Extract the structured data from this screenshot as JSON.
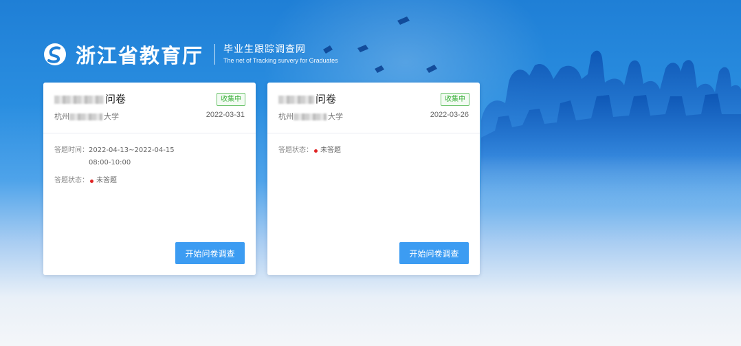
{
  "header": {
    "org_title": "浙江省教育厅",
    "system_title_cn": "毕业生跟踪调查网",
    "system_title_en": "The net of Tracking survery for Graduates"
  },
  "cards": [
    {
      "title_suffix": "问卷",
      "status_badge": "收集中",
      "school_prefix": "杭州",
      "school_suffix": "大学",
      "date": "2022-03-31",
      "answer_time_label": "答题时间：",
      "answer_time_date": "2022-04-13~2022-04-15",
      "answer_time_hours": "08:00-10:00",
      "answer_status_label": "答题状态：",
      "answer_status_value": "未答题",
      "start_button": "开始问卷调查"
    },
    {
      "title_suffix": "问卷",
      "status_badge": "收集中",
      "school_prefix": "杭州",
      "school_suffix": "大学",
      "date": "2022-03-26",
      "answer_status_label": "答题状态：",
      "answer_status_value": "未答题",
      "start_button": "开始问卷调查"
    }
  ],
  "colors": {
    "primary_button": "#3c9cf2",
    "badge_green": "#3bb03b",
    "status_dot": "#e02424",
    "header_blue": "#1f7fd6"
  }
}
